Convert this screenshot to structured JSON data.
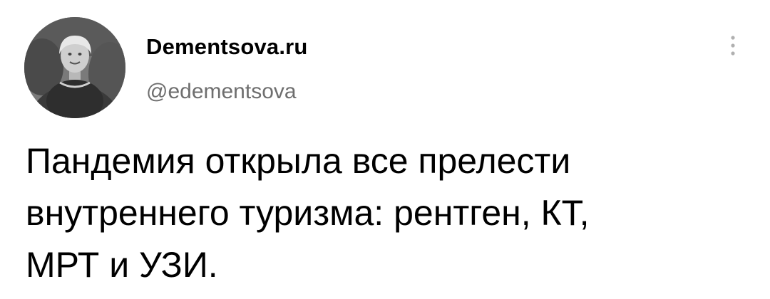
{
  "tweet": {
    "author": {
      "display_name": "Dementsova.ru",
      "handle": "@edementsova",
      "avatar_icon": "user-photo-avatar"
    },
    "more_icon": "more-options-vertical-dots-icon",
    "text_lines": [
      "Пандемия открыла все прелести",
      "внутреннего туризма: рентген, КТ,",
      "МРТ и УЗИ."
    ]
  },
  "colors": {
    "background": "#ffffff",
    "text": "#000000",
    "handle": "#6e6e6e",
    "icon": "#b0b0b0"
  }
}
